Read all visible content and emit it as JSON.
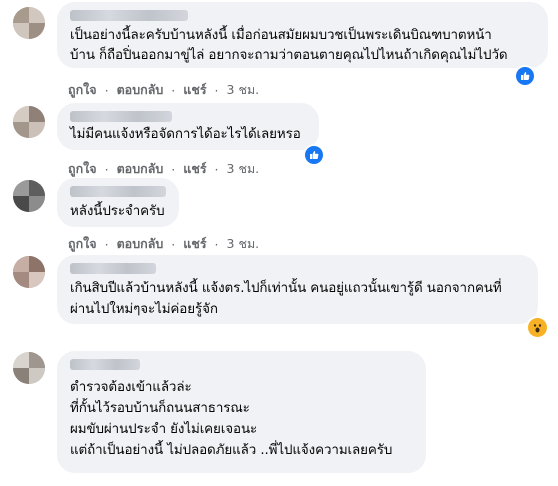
{
  "comments": [
    {
      "lines": [
        "เป็นอย่างนี้ละครับบ้านหลังนี้ เมื่อก่อนสมัยผมบวชเป็นพระเดินบิณฑบาตหน้า",
        "บ้าน ก็ถือปิ่นออกมาขู่ไล่ อยากจะถามว่าตอนตายคุณไปไหนถ้าเกิดคุณไม่ไปวัด"
      ],
      "reaction": "like-icon",
      "reaction_count": "",
      "time": "3 ชม."
    },
    {
      "lines": [
        "ไม่มีคนแจ้งหรือจัดการได้อะไรได้เลยหรอ"
      ],
      "reaction": "like-icon",
      "reaction_count": "",
      "time": "3 ชม."
    },
    {
      "lines": [
        "หลังนี้ประจำครับ"
      ],
      "reaction": "",
      "reaction_count": "",
      "time": "3 ชม."
    },
    {
      "lines": [
        "เกินสิบปีแล้วบ้านหลังนี้ แจ้งตร.ไปก็เท่านั้น คนอยู่แถวนั้นเขารู้ดี นอกจากคนที่",
        "ผ่านไปใหม่ๆจะไม่ค่อยรู้จัก"
      ],
      "reaction": "wow-icon",
      "reaction_count": "",
      "time": "3 ชม."
    },
    {
      "lines": [
        "ตำรวจต้องเข้าแล้วล่ะ",
        "ที่กั้นไว้รอบบ้านก็ถนนสาธารณะ",
        "ผมขับผ่านประจำ ยังไม่เคยเจอนะ",
        "แต่ถ้าเป็นอย่างนี้ ไม่ปลอดภัยแล้ว ..พี่ไปแจ้งความเลยครับ"
      ],
      "reaction": "",
      "reaction_count": "",
      "time": ""
    }
  ],
  "actions": {
    "like": "ถูกใจ",
    "reply": "ตอบกลับ",
    "share": "แชร์",
    "dot": "·"
  },
  "colors": {
    "bubble": "#f0f2f5",
    "text": "#050505",
    "meta": "#65676b",
    "like": "#1877f2",
    "wow": "#f7b125"
  }
}
